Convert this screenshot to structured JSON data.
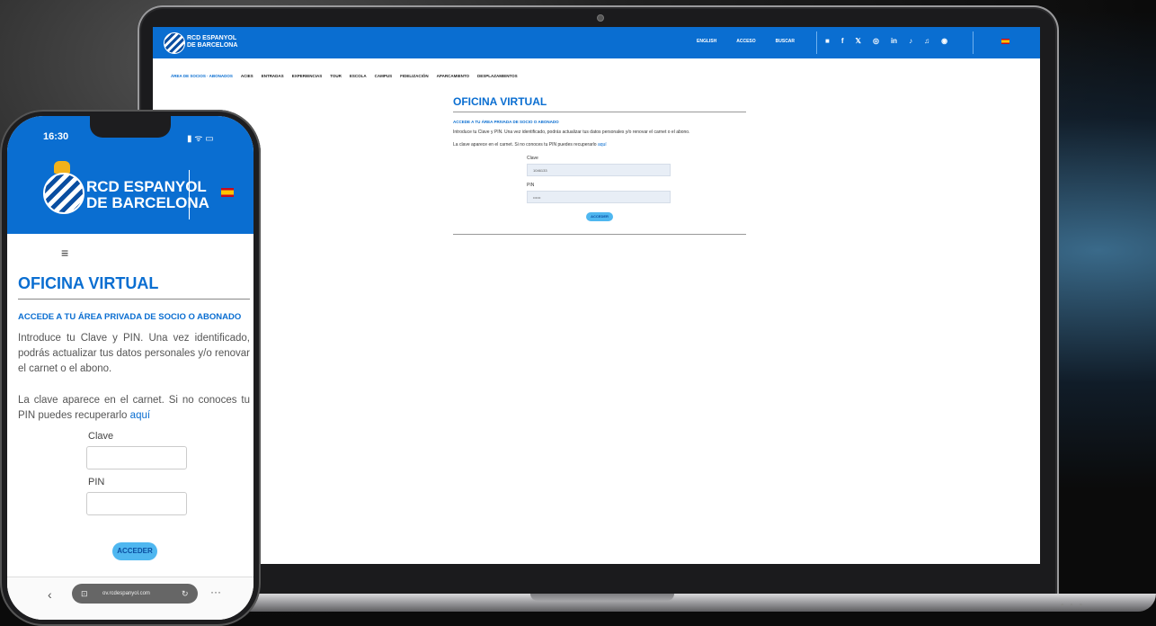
{
  "laptop": {
    "header": {
      "brand_line1": "RCD ESPANYOL",
      "brand_line2": "DE BARCELONA",
      "top_links": [
        "ENGLISH",
        "ACCESO",
        "BUSCAR"
      ],
      "social_icons": [
        "■",
        "f",
        "𝕏",
        "◎",
        "in",
        "♪",
        "♫",
        "◉"
      ]
    },
    "nav": [
      "ÁREA DE SOCIOS · ABONADOS",
      "ACIES",
      "ENTRADAS",
      "EXPERIENCIAS",
      "TOUR",
      "ESCOLA",
      "CAMPUS",
      "FIDELIZACIÓN",
      "APARCAMIENTO",
      "DESPLAZAMIENTOS"
    ],
    "content": {
      "title": "OFICINA VIRTUAL",
      "subtitle": "ACCEDE A TU ÁREA PRIVADA DE SOCIO O ABONADO",
      "intro": "Introduce tu Clave y PIN. Una vez identificado, podrás actualizar tus datos personales y/o renovar el carnet o el abono.",
      "recovery_text": "La clave aparece en el carnet. Si no conoces tu PIN puedes recuperarlo",
      "recovery_link": "aquí",
      "clave_label": "Clave",
      "clave_value": "1046133",
      "pin_label": "PIN",
      "pin_value": "••••••",
      "button": "ACCEDER"
    }
  },
  "phone": {
    "status": {
      "time": "16:30",
      "icons": "▮ ᯤ ▭"
    },
    "brand_line1": "RCD ESPANYOL",
    "brand_line2": "DE BARCELONA",
    "menu_icon": "≡",
    "content": {
      "title": "OFICINA VIRTUAL",
      "subtitle": "ACCEDE A TU ÁREA PRIVADA DE SOCIO O ABONADO",
      "intro": "Introduce tu Clave y PIN. Una vez identificado, podrás actualizar tus datos personales y/o renovar el carnet o el abono.",
      "recovery_text": "La clave aparece en el carnet. Si no conoces tu PIN puedes recuperarlo",
      "recovery_link": "aquí",
      "clave_label": "Clave",
      "pin_label": "PIN",
      "button": "ACCEDER"
    },
    "browser": {
      "url": "ov.rcdespanyol.com",
      "back": "‹",
      "reload": "↻",
      "more": "···",
      "tabs_icon": "⊡"
    }
  },
  "colors": {
    "brand_blue": "#0a6ed1",
    "button_blue": "#4fb7f0"
  }
}
